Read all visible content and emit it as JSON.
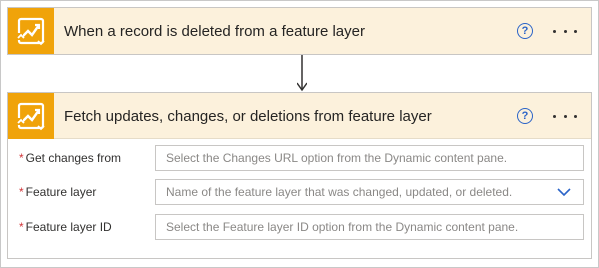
{
  "trigger_card": {
    "title": "When a record is deleted from a feature layer",
    "icon": "arcgis-connector-icon",
    "help_icon": "?",
    "more_icon": "ellipsis-icon"
  },
  "action_card": {
    "title": "Fetch updates, changes, or deletions from feature layer",
    "icon": "arcgis-connector-icon",
    "help_icon": "?",
    "more_icon": "ellipsis-icon",
    "fields": [
      {
        "required_marker": "*",
        "label": "Get changes from",
        "placeholder": "Select the Changes URL option from the Dynamic content pane."
      },
      {
        "required_marker": "*",
        "label": "Feature layer",
        "placeholder": "Name of the feature layer that was changed, updated, or deleted.",
        "dropdown_icon": "chevron-down-icon"
      },
      {
        "required_marker": "*",
        "label": "Feature layer ID",
        "placeholder": "Select the Feature layer ID option from the Dynamic content pane."
      }
    ]
  },
  "colors": {
    "header_bg": "#fcf1dc",
    "icon_bg": "#f0a30a",
    "accent": "#2b64c8",
    "required": "#d13438"
  }
}
